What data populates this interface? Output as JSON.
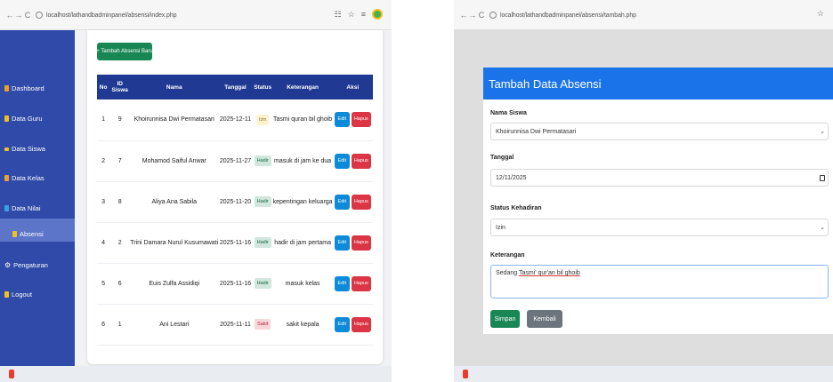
{
  "left": {
    "browser": {
      "back": "←",
      "forward": "→",
      "reload": "C",
      "url": "localhost/lathandbadminpanel/absensi/index.php"
    },
    "sidebar": {
      "items": [
        {
          "label": "Dashboard",
          "color": "#f0a020"
        },
        {
          "label": "Data Guru",
          "color": "#f0c020"
        },
        {
          "label": "Data Siswa",
          "color": "#f0c020"
        },
        {
          "label": "Data Kelas",
          "color": "#e8a030"
        },
        {
          "label": "Data Nilai",
          "color": "#3aa0e0"
        },
        {
          "label": "Absensi",
          "color": "#f0c020"
        },
        {
          "label": "Pengaturan",
          "color": "#ffffff"
        },
        {
          "label": "Logout",
          "color": "#f0c020"
        }
      ]
    },
    "add_button": "+ Tambah Absensi Baru",
    "table": {
      "headers": [
        "No",
        "ID Siswa",
        "Nama",
        "Tanggal",
        "Status",
        "Keterangan",
        "Aksi"
      ],
      "rows": [
        {
          "no": "1",
          "id": "9",
          "nama": "Khoirunnisa Dwi Permatasari",
          "tanggal": "2025-12-11",
          "status": "Izin",
          "status_class": "st-izin",
          "ket": "Tasmi quran bil ghoib"
        },
        {
          "no": "2",
          "id": "7",
          "nama": "Mohamod Saiful Anwar",
          "tanggal": "2025-11-27",
          "status": "Hadir",
          "status_class": "st-hadir",
          "ket": "masuk di jam ke dua"
        },
        {
          "no": "3",
          "id": "8",
          "nama": "Aliya Ana Sabila",
          "tanggal": "2025-11-20",
          "status": "Hadir",
          "status_class": "st-hadir",
          "ket": "kepentingan keluarga"
        },
        {
          "no": "4",
          "id": "2",
          "nama": "Trini Damara Nurul Kusumawati",
          "tanggal": "2025-11-16",
          "status": "Hadir",
          "status_class": "st-hadir",
          "ket": "hadir di jam pertama"
        },
        {
          "no": "5",
          "id": "6",
          "nama": "Euis Zulfa Assidiqi",
          "tanggal": "2025-11-16",
          "status": "Hadir",
          "status_class": "st-hadir",
          "ket": "masuk kelas"
        },
        {
          "no": "6",
          "id": "1",
          "nama": "Ani Lestari",
          "tanggal": "2025-11-11",
          "status": "Sakit",
          "status_class": "st-sakit",
          "ket": "sakit kepala"
        }
      ],
      "edit_label": "Edit",
      "delete_label": "Hapus"
    }
  },
  "right": {
    "browser": {
      "back": "←",
      "forward": "→",
      "reload": "C",
      "url": "localhost/lathandbadminpanel/absensi/tambah.php"
    },
    "form": {
      "title": "Tambah Data Absensi",
      "nama_label": "Nama Siswa",
      "nama_value": "Khoirunnisa Dwi Permatasari",
      "tanggal_label": "Tanggal",
      "tanggal_value": "12/11/2025",
      "status_label": "Status Kehadiran",
      "status_value": "Izin",
      "ket_label": "Keterangan",
      "ket_prefix": "Sedang ",
      "ket_value": "Tasmi' qur'an bil ghoib",
      "simpan": "Simpan",
      "kembali": "Kembali"
    }
  }
}
